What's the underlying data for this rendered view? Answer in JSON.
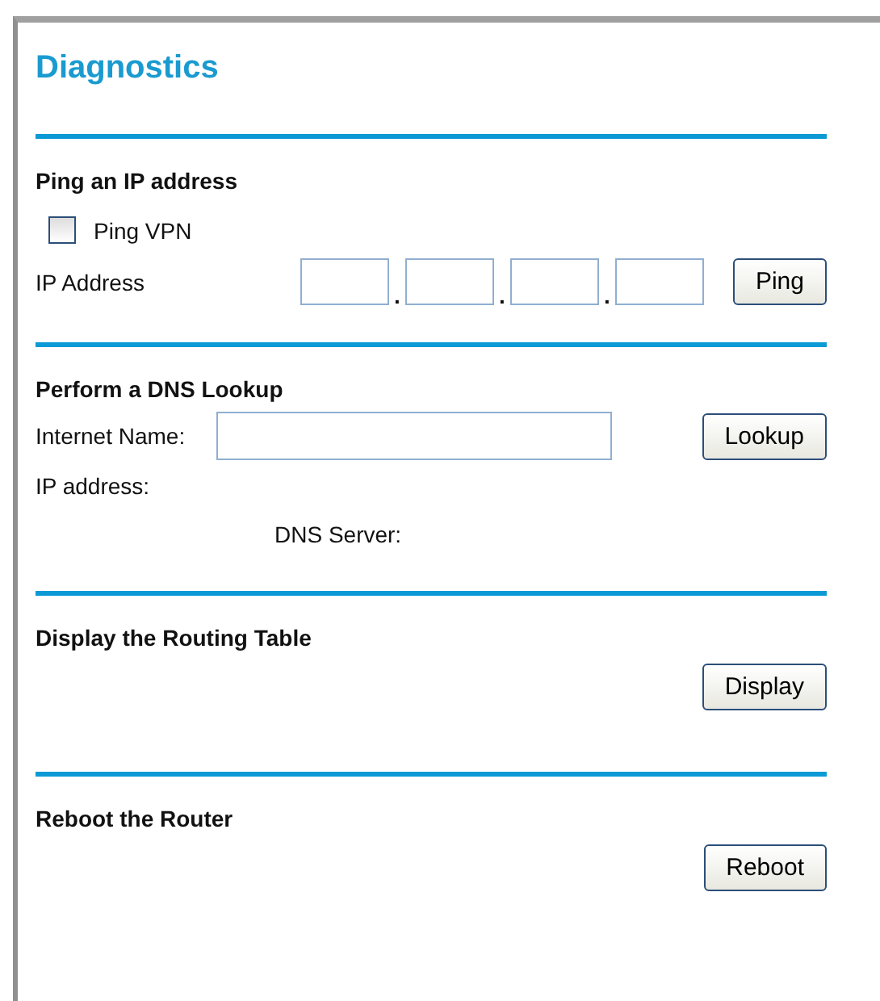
{
  "title": "Diagnostics",
  "ping": {
    "heading": "Ping an IP address",
    "vpn": {
      "label": "Ping VPN",
      "checked": false
    },
    "ip_label": "IP Address",
    "separators": [
      ".",
      ".",
      "."
    ],
    "button": "Ping"
  },
  "dns": {
    "heading": "Perform a DNS Lookup",
    "name_label": "Internet Name:",
    "button": "Lookup",
    "ip_label": "IP address:",
    "server_label": "DNS Server:"
  },
  "routing": {
    "heading": "Display the Routing Table",
    "button": "Display"
  },
  "reboot": {
    "heading": "Reboot the Router",
    "button": "Reboot"
  }
}
